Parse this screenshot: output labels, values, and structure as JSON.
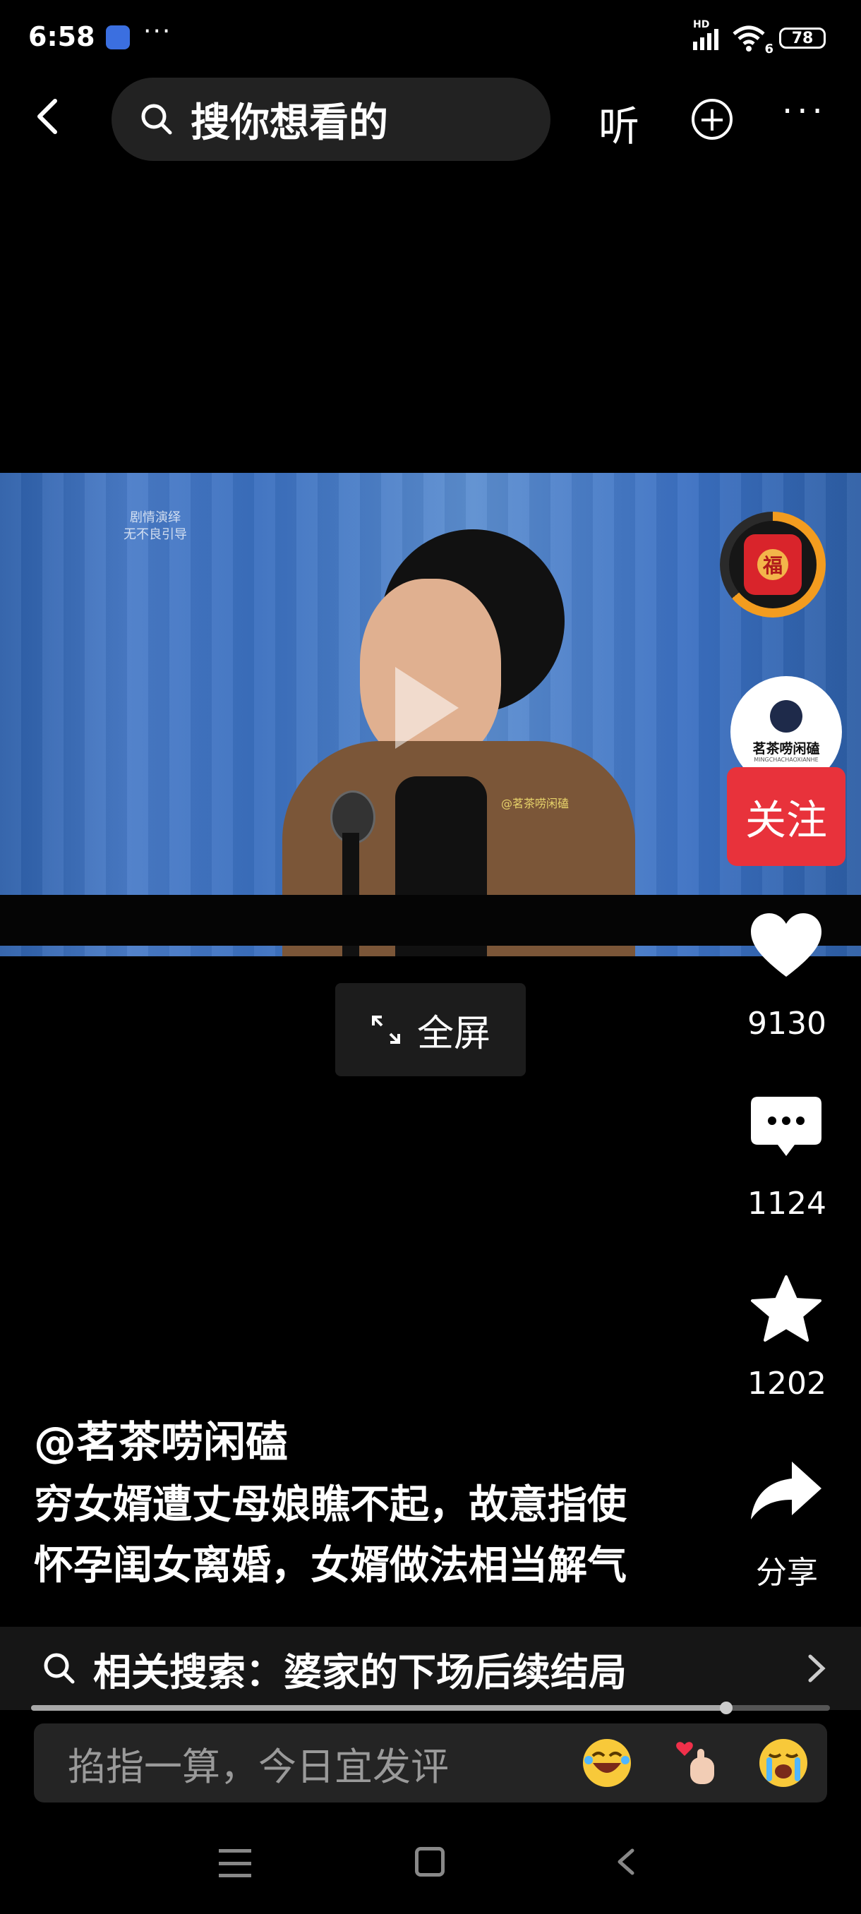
{
  "status_bar": {
    "time": "6:58",
    "dots": "···",
    "network_label": "HD",
    "wifi_label": "6",
    "battery": "78"
  },
  "top_nav": {
    "search_placeholder": "搜你想看的",
    "listen_label": "听",
    "add_label": "+",
    "more_label": "···"
  },
  "video": {
    "watermark_line1": "剧情演绎",
    "watermark_line2": "无不良引导",
    "brand_watermark": "@茗茶唠闲磕"
  },
  "fullscreen_label": "全屏",
  "right_rail": {
    "fu_label": "福",
    "avatar_name": "茗茶唠闲磕",
    "avatar_sub": "MINGCHACHAOXIANHE",
    "follow_label": "关注",
    "like_count": "9130",
    "comment_count": "1124",
    "favorite_count": "1202",
    "share_label": "分享"
  },
  "caption": {
    "author": "@茗茶唠闲磕",
    "line1": "穷女婿遭丈母娘瞧不起，故意指使",
    "line2": "怀孕闺女离婚，女婿做法相当解气"
  },
  "related_search": {
    "label": "相关搜索：婆家的下场后续结局"
  },
  "playback_progress": 0.87,
  "comment_input": {
    "placeholder": "掐指一算，今日宜发评"
  },
  "colors": {
    "follow": "#e8323b",
    "fu_ring": "#f39c1f",
    "background": "#000000"
  },
  "icons": [
    "back-arrow-icon",
    "search-icon",
    "add-circle-icon",
    "more-icon",
    "play-icon",
    "expand-icon",
    "heart-icon",
    "comment-icon",
    "star-icon",
    "share-arrow-icon",
    "chevron-right-icon",
    "laugh-emoji-icon",
    "finger-heart-emoji-icon",
    "crying-emoji-icon",
    "menu-icon",
    "home-icon",
    "back-icon"
  ]
}
